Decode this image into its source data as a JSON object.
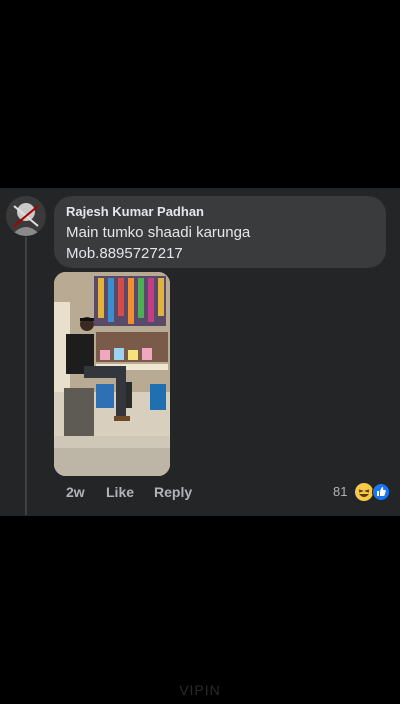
{
  "comment": {
    "author": "Rajesh Kumar Padhan",
    "text_line1": "Main tumko shaadi karunga",
    "text_line2": "Mob.8895727217",
    "time": "2w",
    "like_label": "Like",
    "reply_label": "Reply",
    "reaction_count": "81",
    "reactions": [
      "haha-emoji-icon",
      "like-emoji-icon"
    ]
  },
  "watermark": "VIPIN",
  "colors": {
    "background": "#000000",
    "panel": "#242526",
    "bubble": "#3a3b3c",
    "text_primary": "#e4e6eb",
    "text_secondary": "#b0b3b8",
    "like_blue": "#1877f2",
    "haha_yellow": "#f7c948"
  }
}
